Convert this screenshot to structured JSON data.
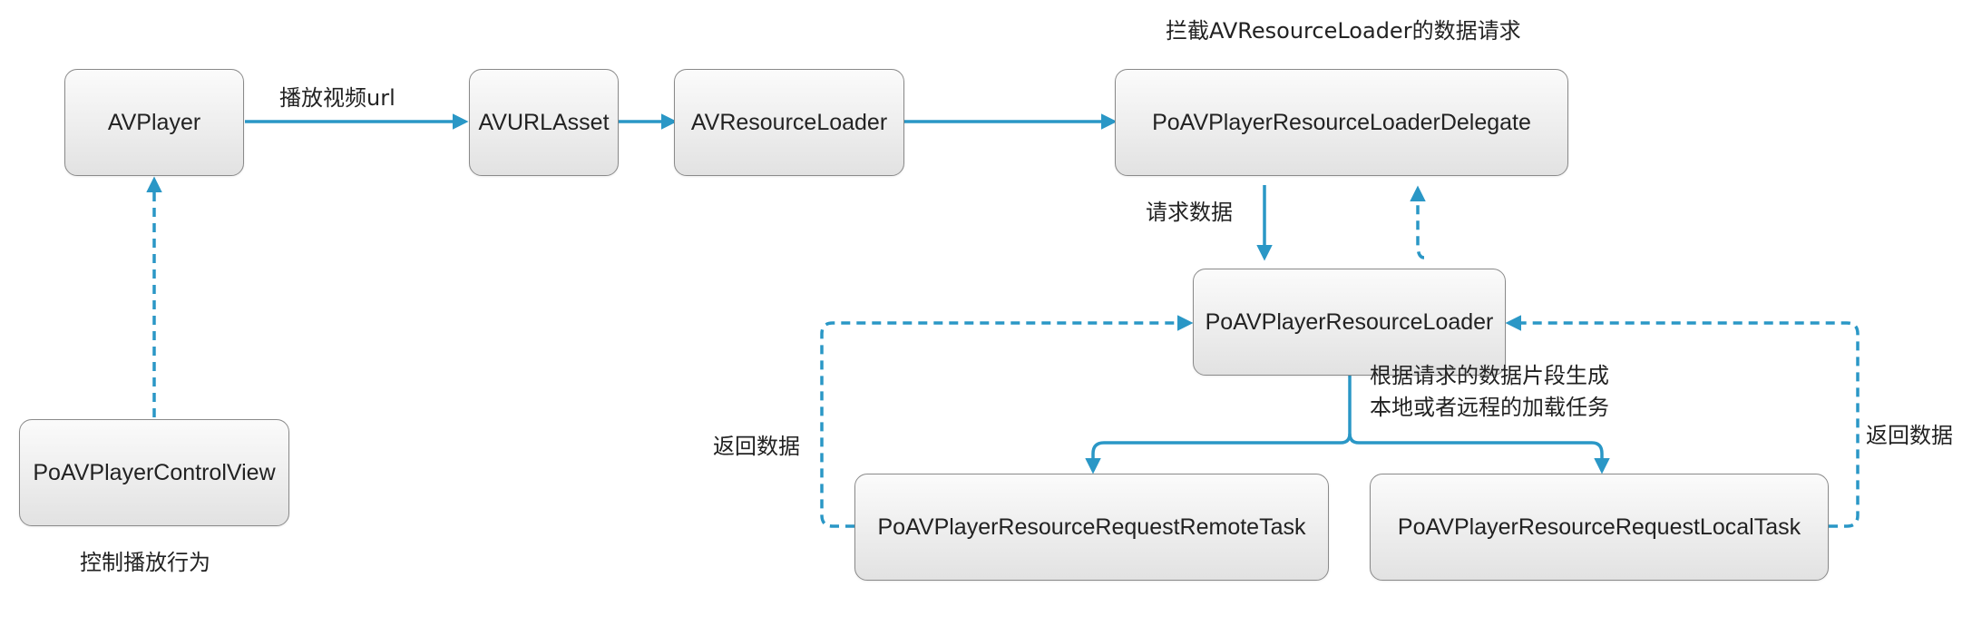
{
  "colors": {
    "connector": "#2a97c6",
    "node_border": "#8a8a8a",
    "node_fill_top": "#fbfbfb",
    "node_fill_bottom": "#e2e2e2"
  },
  "nodes": {
    "avplayer": "AVPlayer",
    "avurlasset": "AVURLAsset",
    "avresourceloader": "AVResourceLoader",
    "delegate": "PoAVPlayerResourceLoaderDelegate",
    "resource_loader": "PoAVPlayerResourceLoader",
    "control_view": "PoAVPlayerControlView",
    "remote_task": "PoAVPlayerResourceRequestRemoteTask",
    "local_task": "PoAVPlayerResourceRequestLocalTask"
  },
  "labels": {
    "play_url": "播放视频url",
    "intercept": "拦截AVResourceLoader的数据请求",
    "request_data": "请求数据",
    "generate_line1": "根据请求的数据片段生成",
    "generate_line2": "本地或者远程的加载任务",
    "return_data_left": "返回数据",
    "return_data_right": "返回数据",
    "control_play": "控制播放行为"
  }
}
